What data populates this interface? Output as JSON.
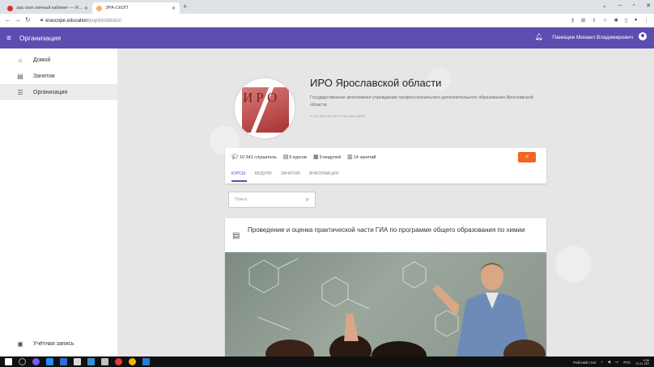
{
  "browser": {
    "tabs": [
      {
        "label": "эра скоп личный кабинет — Я…",
        "favicon_color": "#d93025",
        "active": false
      },
      {
        "label": "ЭРА-СКОП",
        "favicon_color": "#f6b26b",
        "active": true
      }
    ],
    "url_host": "erascope.education",
    "url_path": "/pupil/institution"
  },
  "appbar": {
    "title": "Организация",
    "user_name": "Панищев Михаил Владимирович",
    "color": "#5c4db1"
  },
  "sidebar": {
    "items": [
      {
        "label": "Домой",
        "icon": "home-icon"
      },
      {
        "label": "Занятия",
        "icon": "book-icon"
      },
      {
        "label": "Организация",
        "icon": "list-icon",
        "active": true
      }
    ],
    "account_label": "Учётная запись"
  },
  "org": {
    "name": "ИРО Ярославской области",
    "description": "Государственное автономное учреждение профессионального дополнительного образования Ярославской области",
    "tags": "# ГАУ ДПО ЯО ИРО  # Яр-Ирл  # ДПО",
    "logo_letters": "ИРО"
  },
  "stats": {
    "listeners": "10 341 слушатель",
    "courses": "5 курсов",
    "modules": "9 модулей",
    "lessons": "14 занятий"
  },
  "tabs": [
    "КУРСЫ",
    "МОДУЛИ",
    "ЗАНЯТИЯ",
    "ИНФОРМАЦИЯ"
  ],
  "search": {
    "placeholder": "Поиск"
  },
  "course": {
    "title": "Проведение и оценка практической части ГИА по программе общего образования по химии"
  },
  "taskbar": {
    "desktop_label": "Рабочий стол",
    "lang": "РУС",
    "time": "9:36",
    "date": "24.11.202"
  },
  "colors": {
    "accent": "#5c4db1",
    "share": "#f26522"
  }
}
